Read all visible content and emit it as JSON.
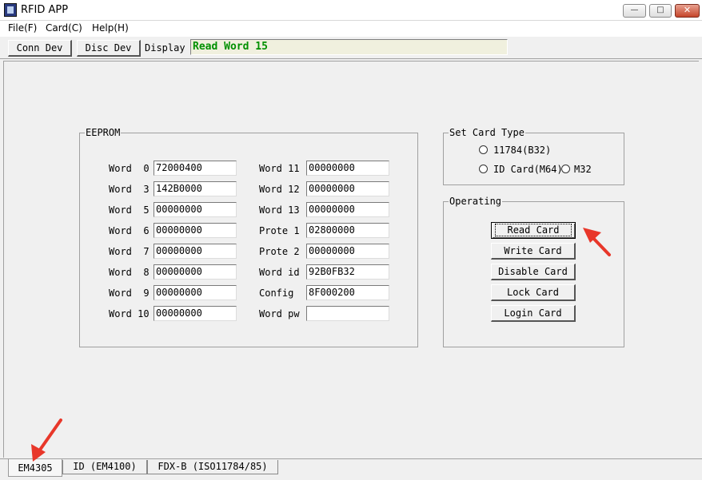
{
  "window": {
    "title": "RFID APP"
  },
  "menu": {
    "file": "File(F)",
    "card": "Card(C)",
    "help": "Help(H)"
  },
  "toolbar": {
    "conn": "Conn Dev",
    "disc": "Disc Dev",
    "display_label": "Display",
    "display_value": "Read Word 15"
  },
  "eeprom": {
    "title": "EEPROM",
    "left": [
      {
        "label": "Word  0",
        "value": "72000400"
      },
      {
        "label": "Word  3",
        "value": "142B0000"
      },
      {
        "label": "Word  5",
        "value": "00000000"
      },
      {
        "label": "Word  6",
        "value": "00000000"
      },
      {
        "label": "Word  7",
        "value": "00000000"
      },
      {
        "label": "Word  8",
        "value": "00000000"
      },
      {
        "label": "Word  9",
        "value": "00000000"
      },
      {
        "label": "Word 10",
        "value": "00000000"
      }
    ],
    "right": [
      {
        "label": "Word 11",
        "value": "00000000"
      },
      {
        "label": "Word 12",
        "value": "00000000"
      },
      {
        "label": "Word 13",
        "value": "00000000"
      },
      {
        "label": "Prote 1",
        "value": "02800000"
      },
      {
        "label": "Prote 2",
        "value": "00000000"
      },
      {
        "label": "Word id",
        "value": "92B0FB32"
      },
      {
        "label": "Config",
        "value": "8F000200"
      },
      {
        "label": "Word pw",
        "value": ""
      }
    ]
  },
  "card_type": {
    "title": "Set Card Type",
    "opt1": "11784(B32)",
    "opt2": "ID Card(M64)",
    "opt3": "M32"
  },
  "operating": {
    "title": "Operating",
    "read": "Read Card",
    "write": "Write Card",
    "disable": "Disable Card",
    "lock": "Lock Card",
    "login": "Login Card"
  },
  "tabs": [
    "EM4305",
    "ID (EM4100)",
    "FDX-B (ISO11784/85)"
  ],
  "colors": {
    "display_text": "#009000",
    "annotation_arrow": "#e8372a"
  }
}
